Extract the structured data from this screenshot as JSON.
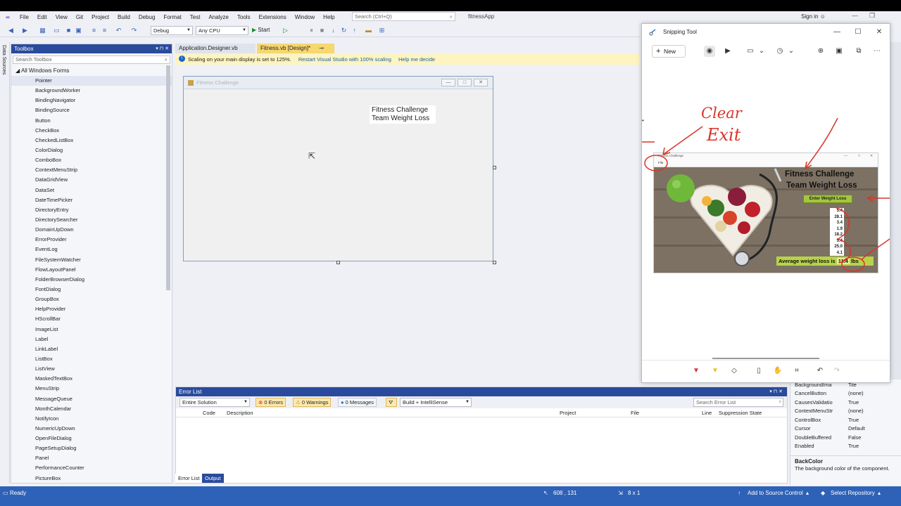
{
  "menubar": {
    "items": [
      "File",
      "Edit",
      "View",
      "Git",
      "Project",
      "Build",
      "Debug",
      "Format",
      "Test",
      "Analyze",
      "Tools",
      "Extensions",
      "Window",
      "Help"
    ],
    "search_placeholder": "Search (Ctrl+Q)",
    "solution_name": "fitnessApp",
    "sign_in": "Sign in"
  },
  "toolbar": {
    "config": "Debug",
    "platform": "Any CPU",
    "start_label": "Start"
  },
  "left_strip": {
    "label": "Data Sources"
  },
  "toolbox": {
    "title": "Toolbox",
    "search_placeholder": "Search Toolbox",
    "group": "All Windows Forms",
    "items": [
      "Pointer",
      "BackgroundWorker",
      "BindingNavigator",
      "BindingSource",
      "Button",
      "CheckBox",
      "CheckedListBox",
      "ColorDialog",
      "ComboBox",
      "ContextMenuStrip",
      "DataGridView",
      "DataSet",
      "DateTimePicker",
      "DirectoryEntry",
      "DirectorySearcher",
      "DomainUpDown",
      "ErrorProvider",
      "EventLog",
      "FileSystemWatcher",
      "FlowLayoutPanel",
      "FolderBrowserDialog",
      "FontDialog",
      "GroupBox",
      "HelpProvider",
      "HScrollBar",
      "ImageList",
      "Label",
      "LinkLabel",
      "ListBox",
      "ListView",
      "MaskedTextBox",
      "MenuStrip",
      "MessageQueue",
      "MonthCalendar",
      "NotifyIcon",
      "NumericUpDown",
      "OpenFileDialog",
      "PageSetupDialog",
      "Panel",
      "PerformanceCounter",
      "PictureBox"
    ]
  },
  "doc_tabs": {
    "tab1": "Application.Designer.vb",
    "tab2": "Fitness.vb [Design]*"
  },
  "infobar": {
    "message": "Scaling on your main display is set to 125%.",
    "link1": "Restart Visual Studio with 100% scaling",
    "link2": "Help me decide"
  },
  "form": {
    "title": "Fitness Challenge",
    "label_line1": "Fitness Challenge",
    "label_line2": "Team Weight Loss"
  },
  "error_list": {
    "title": "Error List",
    "scope": "Entire Solution",
    "errors": "0 Errors",
    "warnings": "0 Warnings",
    "messages": "0 Messages",
    "build_filter": "Build + IntelliSense",
    "search_placeholder": "Search Error List",
    "columns": [
      "Code",
      "Description",
      "Project",
      "File",
      "Line",
      "Suppression State"
    ],
    "bottom_tabs": [
      "Error List",
      "Output"
    ]
  },
  "properties": {
    "rows": [
      {
        "name": "BackgroundIma",
        "value": "Tile"
      },
      {
        "name": "CancelButton",
        "value": "(none)"
      },
      {
        "name": "CausesValidatio",
        "value": "True"
      },
      {
        "name": "ContextMenuStr",
        "value": "(none)"
      },
      {
        "name": "ControlBox",
        "value": "True"
      },
      {
        "name": "Cursor",
        "value": "Default"
      },
      {
        "name": "DoubleBuffered",
        "value": "False"
      },
      {
        "name": "Enabled",
        "value": "True"
      }
    ],
    "desc_title": "BackColor",
    "desc_text": "The background color of the component."
  },
  "statusbar": {
    "ready": "Ready",
    "coords": "608 , 131",
    "size": "8 x 1",
    "source_control": "Add to Source Control",
    "repo": "Select Repository"
  },
  "snipping_tool": {
    "title": "Snipping Tool",
    "new_label": "New",
    "annotation_clear": "Clear",
    "annotation_exit": "Exit",
    "shot": {
      "window_title": "Fitness Challenge",
      "menu_file": "File",
      "title_line1": "Fitness Challenge",
      "title_line2": "Team Weight Loss",
      "button": "Enter Weight Loss",
      "values": [
        "5.4",
        "28.1",
        "3.4",
        "1.9",
        "18.2",
        "5.4",
        "25.0",
        "4.1"
      ],
      "avg_prefix": "Average weight loss is",
      "avg_value": "11.4",
      "avg_unit": "lbs"
    }
  },
  "colors": {
    "accent": "#2a4a9c",
    "status_bar": "#2e62b8",
    "active_tab": "#f6d770",
    "ink": "#d9342b"
  }
}
